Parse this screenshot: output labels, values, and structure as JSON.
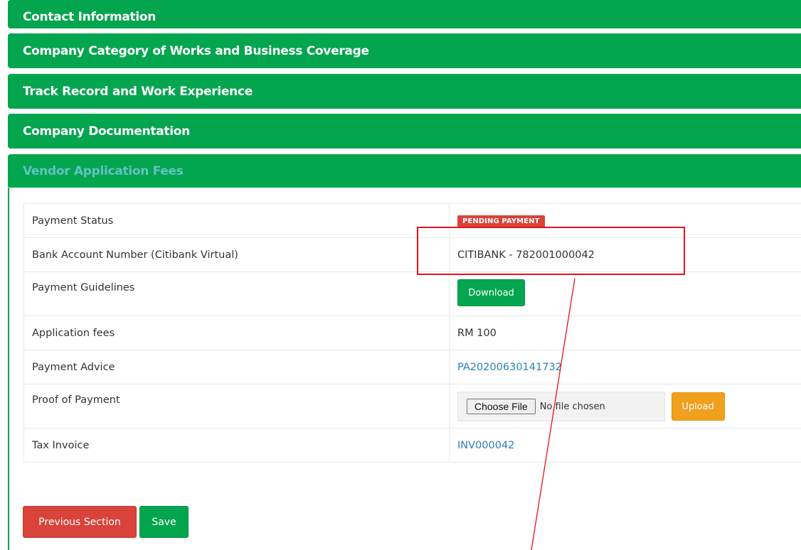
{
  "sections": {
    "contact": "Contact Information",
    "category": "Company Category of Works and Business Coverage",
    "track_record": "Track Record and Work Experience",
    "documentation": "Company Documentation",
    "fees": "Vendor Application Fees"
  },
  "fees_table": {
    "payment_status": {
      "label": "Payment Status",
      "badge": "PENDING PAYMENT"
    },
    "bank_account": {
      "label": "Bank Account Number (Citibank Virtual)",
      "value": "CITIBANK - 782001000042"
    },
    "guidelines": {
      "label": "Payment Guidelines",
      "button": "Download"
    },
    "app_fees": {
      "label": "Application fees",
      "value": "RM 100"
    },
    "payment_advice": {
      "label": "Payment Advice",
      "link": "PA20200630141732"
    },
    "proof": {
      "label": "Proof of Payment",
      "choose_file": "Choose File",
      "no_file": "No file chosen",
      "upload": "Upload"
    },
    "tax_invoice": {
      "label": "Tax Invoice",
      "link": "INV000042"
    }
  },
  "footer": {
    "previous": "Previous Section",
    "save": "Save"
  },
  "colors": {
    "header_green": "#04a54f",
    "badge_red": "#d9433a",
    "link_blue": "#2c7fb8",
    "upload_orange": "#f0a01c",
    "annotation_red": "#e8121a"
  }
}
